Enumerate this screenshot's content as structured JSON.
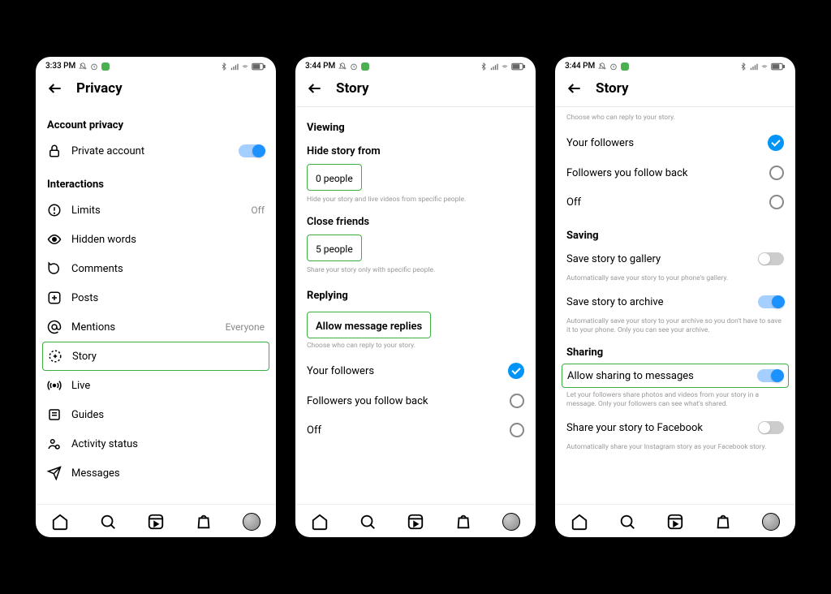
{
  "screen1": {
    "status_time": "3:33 PM",
    "title": "Privacy",
    "section_account": "Account privacy",
    "private_account": "Private account",
    "section_interactions": "Interactions",
    "limits": "Limits",
    "limits_value": "Off",
    "hidden_words": "Hidden words",
    "comments": "Comments",
    "posts": "Posts",
    "mentions": "Mentions",
    "mentions_value": "Everyone",
    "story": "Story",
    "live": "Live",
    "guides": "Guides",
    "activity_status": "Activity status",
    "messages": "Messages"
  },
  "screen2": {
    "status_time": "3:44 PM",
    "title": "Story",
    "section_viewing": "Viewing",
    "hide_story": "Hide story from",
    "hide_story_value": "0 people",
    "hide_story_hint": "Hide your story and live videos from specific people.",
    "close_friends": "Close friends",
    "close_friends_value": "5 people",
    "close_friends_hint": "Share your story only with specific people.",
    "section_replying": "Replying",
    "allow_replies": "Allow message replies",
    "allow_replies_hint": "Choose who can reply to your story.",
    "opt_followers": "Your followers",
    "opt_follow_back": "Followers you follow back",
    "opt_off": "Off"
  },
  "screen3": {
    "status_time": "3:44 PM",
    "title": "Story",
    "hint_top": "Choose who can reply to your story.",
    "opt_followers": "Your followers",
    "opt_follow_back": "Followers you follow back",
    "opt_off": "Off",
    "section_saving": "Saving",
    "save_gallery": "Save story to gallery",
    "save_gallery_hint": "Automatically save your story to your phone's gallery.",
    "save_archive": "Save story to archive",
    "save_archive_hint": "Automatically save your story to your archive so you don't have to save it to your phone. Only you can see your archive.",
    "section_sharing": "Sharing",
    "allow_sharing": "Allow sharing to messages",
    "allow_sharing_hint": "Let your followers share photos and videos from your story in a message. Only your followers can see what's shared.",
    "share_facebook": "Share your story to Facebook",
    "share_facebook_hint": "Automatically share your Instagram story as your Facebook story."
  }
}
